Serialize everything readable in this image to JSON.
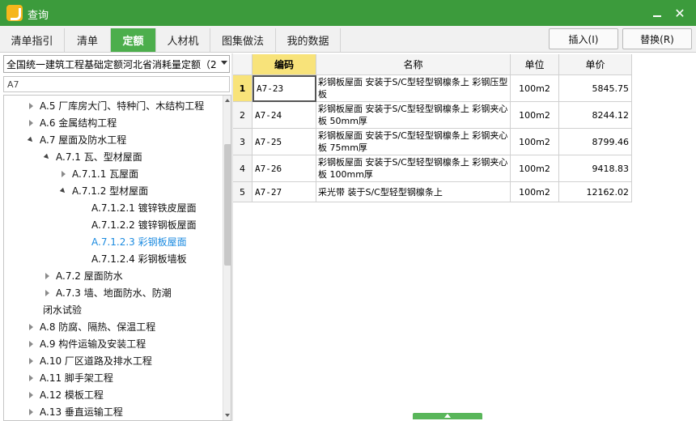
{
  "window": {
    "title": "查询"
  },
  "tabs": [
    {
      "label": "清单指引"
    },
    {
      "label": "清单"
    },
    {
      "label": "定额"
    },
    {
      "label": "人材机"
    },
    {
      "label": "图集做法"
    },
    {
      "label": "我的数据"
    }
  ],
  "active_tab": "定额",
  "actions": {
    "insert_label": "插入(I)",
    "replace_label": "替换(R)"
  },
  "left": {
    "combo_value": "全国统一建筑工程基础定额河北省消耗量定额（2",
    "filter_text": "A7",
    "tree": [
      {
        "label": "A.5 厂库房大门、特种门、木结构工程",
        "state": "collapsed",
        "level": 0
      },
      {
        "label": "A.6 金属结构工程",
        "state": "collapsed",
        "level": 0
      },
      {
        "label": "A.7 屋面及防水工程",
        "state": "expanded",
        "level": 0
      },
      {
        "label": "A.7.1 瓦、型材屋面",
        "state": "expanded",
        "level": 1
      },
      {
        "label": "A.7.1.1 瓦屋面",
        "state": "collapsed",
        "level": 2
      },
      {
        "label": "A.7.1.2 型材屋面",
        "state": "expanded",
        "level": 2
      },
      {
        "label": "A.7.1.2.1 镀锌铁皮屋面",
        "state": "none",
        "level": 3
      },
      {
        "label": "A.7.1.2.2 镀锌钢板屋面",
        "state": "none",
        "level": 3
      },
      {
        "label": "A.7.1.2.3 彩钢板屋面",
        "state": "none",
        "level": 3,
        "selected": true
      },
      {
        "label": "A.7.1.2.4 彩钢板墙板",
        "state": "none",
        "level": 3
      },
      {
        "label": "A.7.2 屋面防水",
        "state": "collapsed",
        "level": 1
      },
      {
        "label": "A.7.3 墙、地面防水、防潮",
        "state": "collapsed",
        "level": 1
      },
      {
        "label": "闭水试验",
        "state": "none",
        "level": 1
      },
      {
        "label": "A.8 防腐、隔热、保温工程",
        "state": "collapsed",
        "level": 0
      },
      {
        "label": "A.9 构件运输及安装工程",
        "state": "collapsed",
        "level": 0
      },
      {
        "label": "A.10 厂区道路及排水工程",
        "state": "collapsed",
        "level": 0
      },
      {
        "label": "A.11 脚手架工程",
        "state": "collapsed",
        "level": 0
      },
      {
        "label": "A.12 模板工程",
        "state": "collapsed",
        "level": 0
      },
      {
        "label": "A.13 垂直运输工程",
        "state": "collapsed",
        "level": 0
      }
    ]
  },
  "grid": {
    "headers": {
      "code": "编码",
      "name": "名称",
      "unit": "单位",
      "price": "单价"
    },
    "rows": [
      {
        "num": "1",
        "code": "A7-23",
        "name": "彩钢板屋面 安装于S/C型轻型钢檩条上 彩钢压型板",
        "unit": "100m2",
        "price": "5845.75"
      },
      {
        "num": "2",
        "code": "A7-24",
        "name": "彩钢板屋面 安装于S/C型轻型钢檩条上 彩钢夹心板 50mm厚",
        "unit": "100m2",
        "price": "8244.12"
      },
      {
        "num": "3",
        "code": "A7-25",
        "name": "彩钢板屋面 安装于S/C型轻型钢檩条上 彩钢夹心板 75mm厚",
        "unit": "100m2",
        "price": "8799.46"
      },
      {
        "num": "4",
        "code": "A7-26",
        "name": "彩钢板屋面 安装于S/C型轻型钢檩条上 彩钢夹心板 100mm厚",
        "unit": "100m2",
        "price": "9418.83"
      },
      {
        "num": "5",
        "code": "A7-27",
        "name": "采光带 装于S/C型轻型钢檩条上",
        "unit": "100m2",
        "price": "12162.02"
      }
    ]
  },
  "colors": {
    "titlebar": "#3c9b3c",
    "active_tab": "#4cae4c",
    "selection": "#1c8be0",
    "header_highlight": "#f8e37a"
  }
}
